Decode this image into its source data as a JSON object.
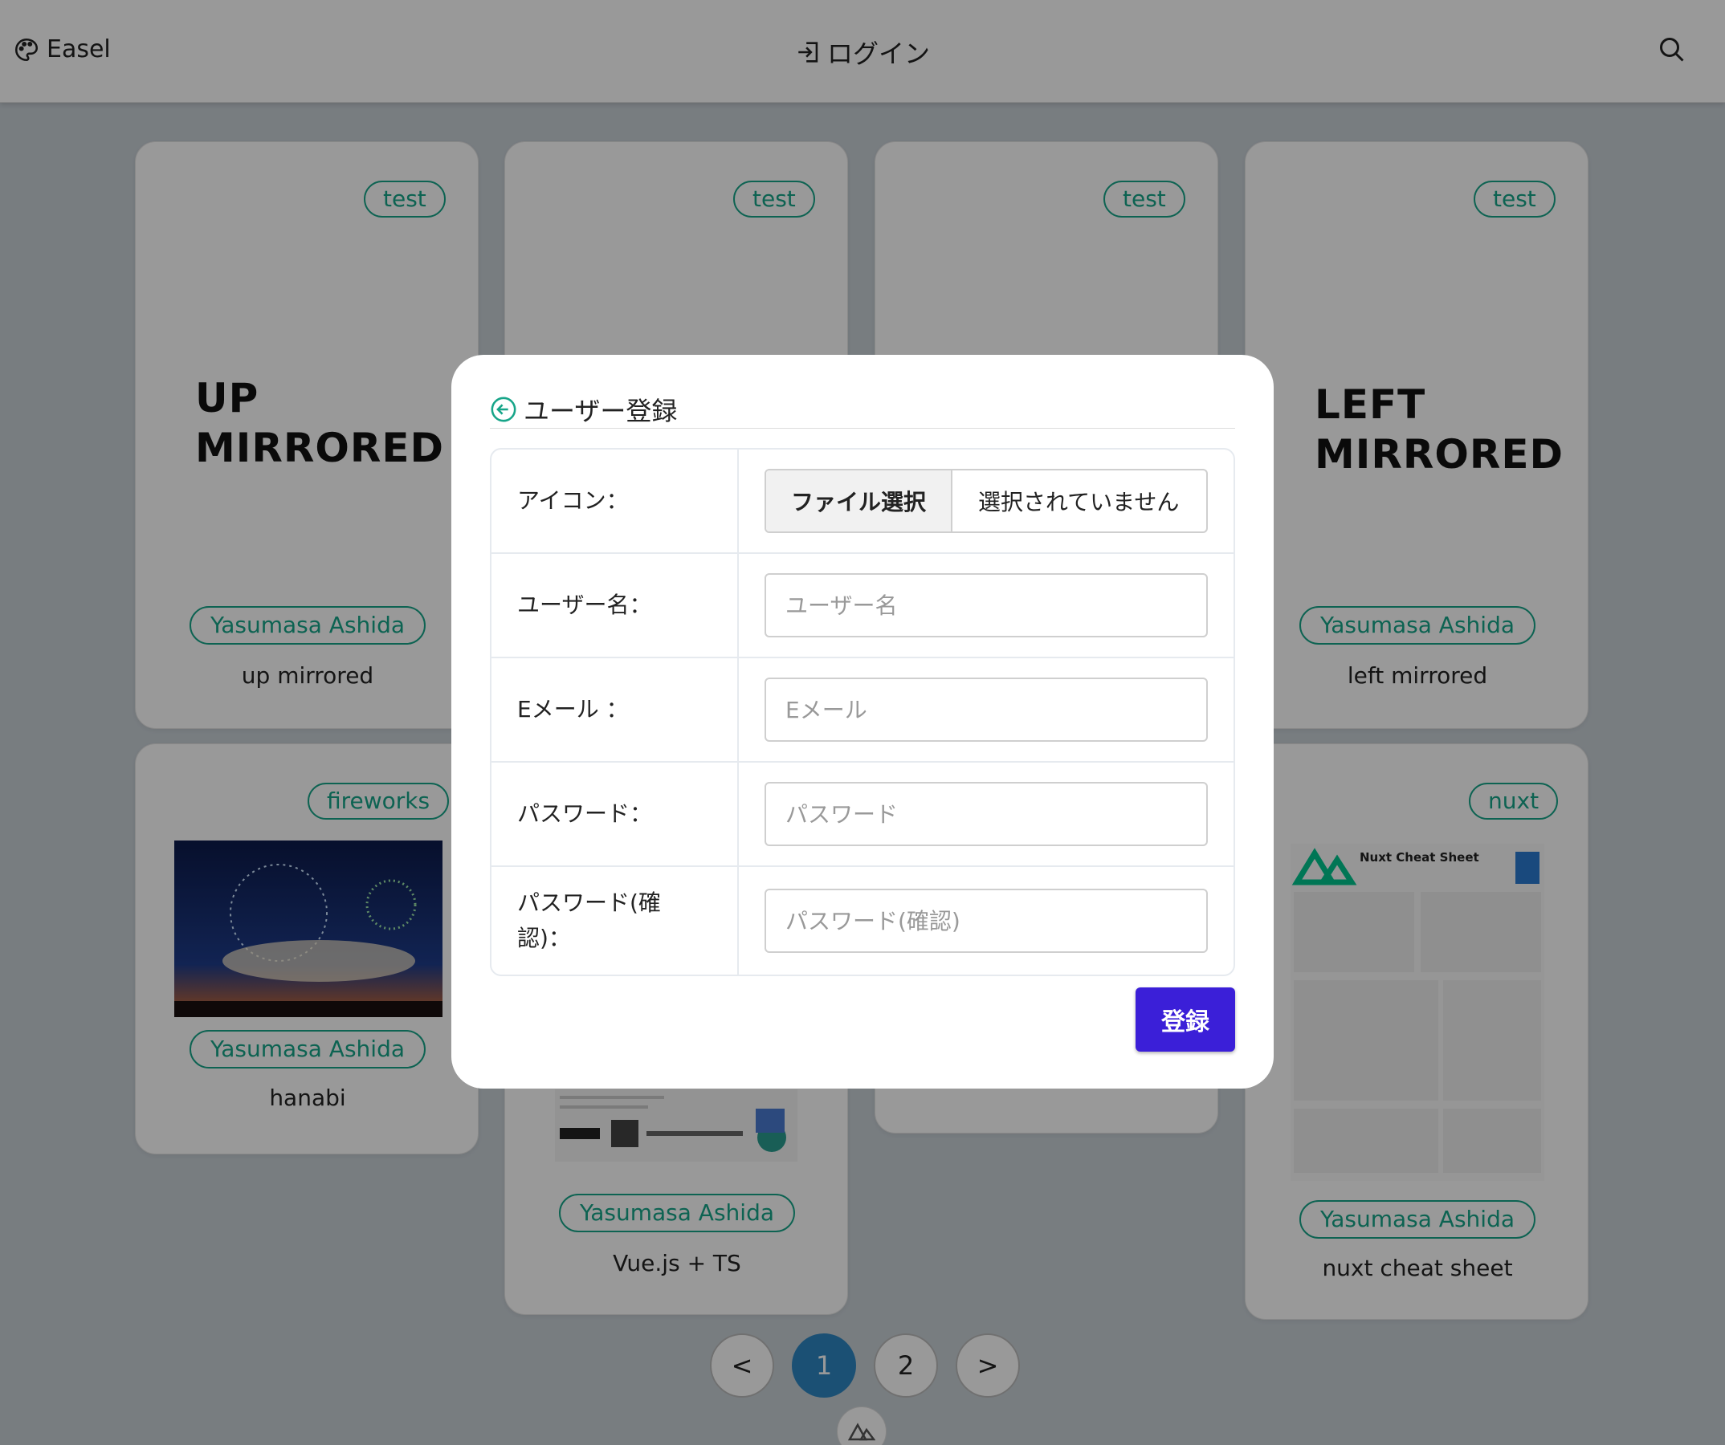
{
  "header": {
    "brand": "Easel",
    "login_label": "ログイン"
  },
  "cards": [
    {
      "tag": "test",
      "bigtext": [
        "UP",
        "MIRRORED"
      ],
      "author": "Yasumasa Ashida",
      "title": "up mirrored"
    },
    {
      "tag": "test"
    },
    {
      "tag": "test"
    },
    {
      "tag": "test",
      "bigtext": [
        "LEFT",
        "MIRRORED"
      ],
      "author": "Yasumasa Ashida",
      "title": "left mirrored"
    },
    {
      "tag": "fireworks",
      "author": "Yasumasa Ashida",
      "title": "hanabi"
    },
    {
      "author": "Yasumasa Ashida",
      "title": "Vue.js + TS"
    },
    {
      "tag": "nuxt",
      "thumb_title": "Nuxt Cheat Sheet",
      "author": "Yasumasa Ashida",
      "title": "nuxt cheat sheet"
    }
  ],
  "pagination": {
    "prev": "<",
    "pages": [
      "1",
      "2"
    ],
    "active": "1",
    "next": ">"
  },
  "modal": {
    "title": "ユーザー登録",
    "fields": {
      "icon_label": "アイコン：",
      "file_button": "ファイル選択",
      "file_status": "選択されていません",
      "username_label": "ユーザー名：",
      "username_placeholder": "ユーザー名",
      "email_label": "Eメール ：",
      "email_placeholder": "Eメール",
      "password_label": "パスワード：",
      "password_placeholder": "パスワード",
      "password_confirm_label": "パスワード(確認)：",
      "password_confirm_placeholder": "パスワード(確認)"
    },
    "submit_label": "登録",
    "accent_color": "#3b1fd8"
  },
  "colors": {
    "tag": "#17a589",
    "page_active": "#2e86c1"
  }
}
